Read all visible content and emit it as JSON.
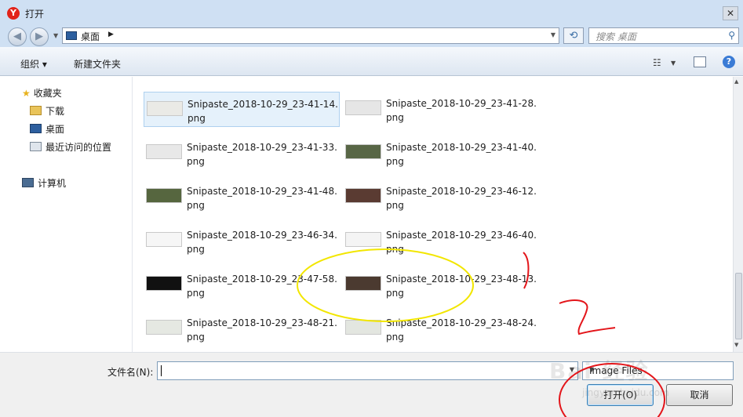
{
  "window": {
    "title": "打开",
    "close_glyph": "✕"
  },
  "nav": {
    "address_path": "桌面",
    "search_placeholder": "搜索 桌面"
  },
  "toolbar": {
    "organize": "组织 ▾",
    "new_folder": "新建文件夹",
    "help_glyph": "?"
  },
  "sidebar": {
    "favorites": "收藏夹",
    "downloads": "下载",
    "desktop": "桌面",
    "recent": "最近访问的位置",
    "computer": "计算机"
  },
  "files": [
    {
      "name": "Snipaste_2018-10-29_23-41-14.\npng",
      "thumb": "#eaeae6",
      "selected": true
    },
    {
      "name": "Snipaste_2018-10-29_23-41-28.\npng",
      "thumb": "#e6e6e6",
      "selected": false
    },
    {
      "name": "Snipaste_2018-10-29_23-41-33.\npng",
      "thumb": "#e8e8e8",
      "selected": false
    },
    {
      "name": "Snipaste_2018-10-29_23-41-40.\npng",
      "thumb": "#586646",
      "selected": false
    },
    {
      "name": "Snipaste_2018-10-29_23-41-48.\npng",
      "thumb": "#56663f",
      "selected": false
    },
    {
      "name": "Snipaste_2018-10-29_23-46-12.\npng",
      "thumb": "#5a3b32",
      "selected": false
    },
    {
      "name": "Snipaste_2018-10-29_23-46-34.\npng",
      "thumb": "#f6f6f6",
      "selected": false
    },
    {
      "name": "Snipaste_2018-10-29_23-46-40.\npng",
      "thumb": "#f4f4f4",
      "selected": false
    },
    {
      "name": "Snipaste_2018-10-29_23-47-58.\npng",
      "thumb": "#111111",
      "selected": false
    },
    {
      "name": "Snipaste_2018-10-29_23-48-13.\npng",
      "thumb": "#4b3a30",
      "selected": false
    },
    {
      "name": "Snipaste_2018-10-29_23-48-21.\npng",
      "thumb": "#e5e8e2",
      "selected": false
    },
    {
      "name": "Snipaste_2018-10-29_23-48-24.\npng",
      "thumb": "#e3e6e0",
      "selected": false
    }
  ],
  "partial_row": {
    "label": "png"
  },
  "bottom": {
    "filename_label": "文件名(N):",
    "filename_value": "",
    "filter_value": "Image Files",
    "open_button": "打开(O)",
    "cancel_button": "取消"
  },
  "watermark": {
    "text": "Bai 经验",
    "subtext": "jingyan.baidu.com"
  },
  "colors": {
    "selection": "#e5f1fb",
    "accent": "#3a7bd5",
    "annotation_yellow": "#f2e600",
    "annotation_red": "#e3151a"
  }
}
